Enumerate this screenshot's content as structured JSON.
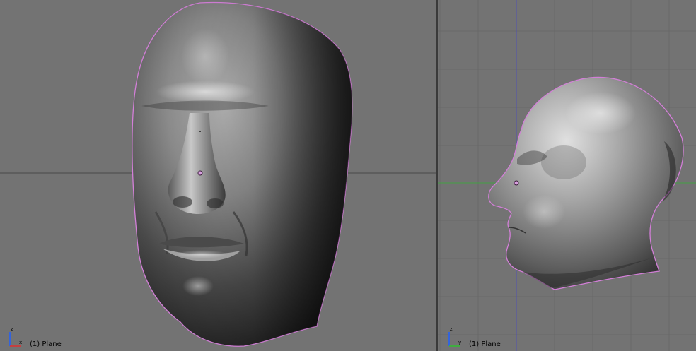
{
  "viewports": {
    "front": {
      "object_label": "(1) Plane",
      "axis_labels": {
        "vertical": "z",
        "horizontal": "x"
      },
      "colors": {
        "background": "#737373",
        "grid": "#6a6a6a",
        "x_axis": "#4a4a4a",
        "outline": "#d37fd8"
      }
    },
    "side": {
      "object_label": "(1) Plane",
      "axis_labels": {
        "vertical": "z",
        "horizontal": "y"
      },
      "colors": {
        "background": "#737373",
        "grid": "#676767",
        "y_axis": "#43a043",
        "z_axis": "#5050b0",
        "outline": "#d37fd8"
      }
    }
  },
  "icons": [
    "axis-gizmo-icon",
    "pivot-point-icon",
    "head-mesh"
  ]
}
